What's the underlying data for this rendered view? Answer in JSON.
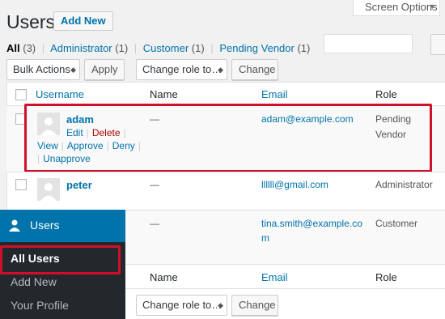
{
  "page": {
    "title": "Users",
    "add_new_label": "Add New",
    "screen_options_label": "Screen Options"
  },
  "filters": [
    {
      "label": "All",
      "count": "(3)"
    },
    {
      "label": "Administrator",
      "count": "(1)"
    },
    {
      "label": "Customer",
      "count": "(1)"
    },
    {
      "label": "Pending Vendor",
      "count": "(1)"
    }
  ],
  "toolbar": {
    "bulk_actions": "Bulk Actions",
    "apply": "Apply",
    "change_role": "Change role to…",
    "change": "Change"
  },
  "table": {
    "headers": {
      "username": "Username",
      "name": "Name",
      "email": "Email",
      "role": "Role"
    },
    "rows": [
      {
        "username": "adam",
        "name": "—",
        "email": "adam@example.com",
        "role_line1": "Pending",
        "role_line2": "Vendor",
        "actions": {
          "edit": "Edit",
          "delete": "Delete",
          "view": "View",
          "approve": "Approve",
          "deny": "Deny",
          "unapprove": "Unapprove"
        }
      },
      {
        "username": "peter",
        "name": "—",
        "email": "llllll@gmail.com",
        "role": "Administrator"
      },
      {
        "name": "—",
        "email_line1": "tina.smith@example.co",
        "email_line2": "m",
        "role": "Customer"
      }
    ]
  },
  "menu": {
    "title": "Users",
    "items": [
      "All Users",
      "Add New",
      "Your Profile"
    ]
  },
  "colors": {
    "accent": "#0073aa",
    "highlight": "#d0102b",
    "menu_bg": "#23282d"
  }
}
